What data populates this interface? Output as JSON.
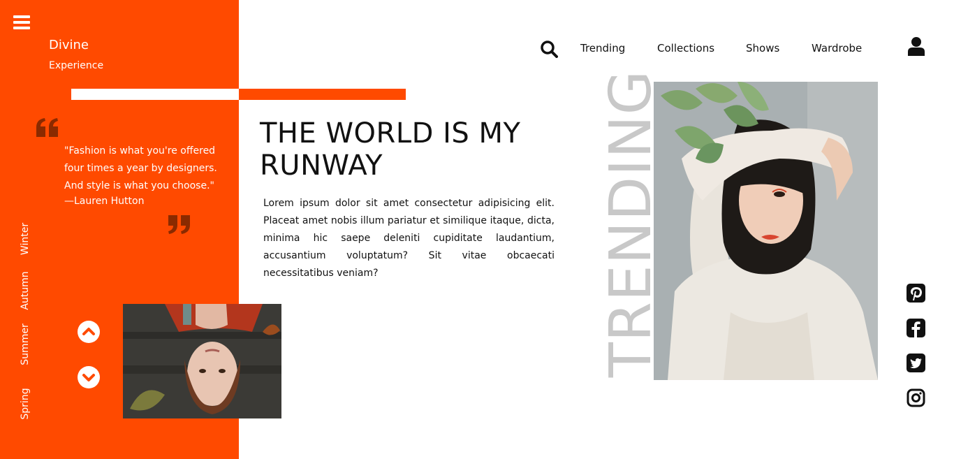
{
  "brand": {
    "title": "Divine",
    "subtitle": "Experience"
  },
  "menu": {
    "icon": "hamburger-menu-icon"
  },
  "quote": {
    "text": "\"Fashion is what you're offered four times a year by designers. And style is what you choose.\"",
    "author": "—Lauren Hutton"
  },
  "seasons": [
    "Winter",
    "Autumn",
    "Summer",
    "Spring"
  ],
  "carousel": {
    "up_icon": "chevron-up-circle-icon",
    "down_icon": "chevron-down-circle-icon"
  },
  "headline": "THE WORLD IS MY RUNWAY",
  "body": "Lorem ipsum dolor sit amet consectetur adipisicing elit. Placeat amet nobis illum pariatur et similique itaque, dicta, minima hic saepe deleniti cupiditate laudantium, accusantium voluptatum? Sit vitae obcaecati necessitatibus veniam?",
  "nav": {
    "items": [
      "Trending",
      "Collections",
      "Shows",
      "Wardrobe"
    ]
  },
  "trending_label": "TRENDING",
  "social": [
    "pinterest-icon",
    "facebook-icon",
    "twitter-icon",
    "instagram-icon"
  ],
  "colors": {
    "accent": "#ff4a00",
    "text": "#111111",
    "muted": "#c8c8c8",
    "background": "#ffffff"
  }
}
